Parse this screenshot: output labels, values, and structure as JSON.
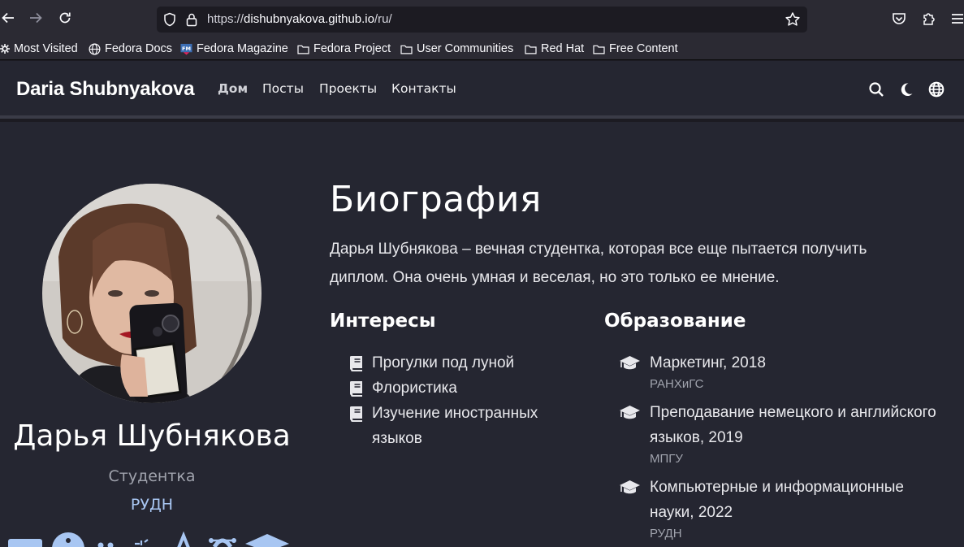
{
  "browser": {
    "url_prefix": "https://",
    "url_host": "dishubnyakova.github.io",
    "url_path": "/ru/",
    "bookmarks": [
      {
        "label": "Most Visited",
        "icon": "gear-icon"
      },
      {
        "label": "Fedora Docs",
        "icon": "globe-icon"
      },
      {
        "label": "Fedora Magazine",
        "icon": "fm-favicon-icon"
      },
      {
        "label": "Fedora Project",
        "icon": "folder-icon"
      },
      {
        "label": "User Communities",
        "icon": "folder-icon"
      },
      {
        "label": "Red Hat",
        "icon": "folder-icon"
      },
      {
        "label": "Free Content",
        "icon": "folder-icon"
      }
    ]
  },
  "site": {
    "brand": "Daria Shubnyakova",
    "nav": [
      "Дом",
      "Посты",
      "Проекты",
      "Контакты"
    ],
    "active_nav": "Дом"
  },
  "profile": {
    "name": "Дарья Шубнякова",
    "role": "Студентка",
    "org": "РУДН"
  },
  "bio": {
    "title": "Биография",
    "line1": "Дарья Шубнякова – вечная студентка, которая все еще пытается получить",
    "line2": "диплом. Она очень умная и веселая, но это только ее мнение."
  },
  "interests": {
    "title": "Интересы",
    "items": [
      "Прогулки под луной",
      "Флористика",
      "Изучение иностранных языков"
    ]
  },
  "education": {
    "title": "Образование",
    "items": [
      {
        "course": "Маркетинг, 2018",
        "institution": "РАНХиГС"
      },
      {
        "course": "Преподавание немецкого и английского языков, 2019",
        "institution": "МПГУ"
      },
      {
        "course": "Компьютерные и информационные науки, 2022",
        "institution": "РУДН"
      }
    ]
  },
  "colors": {
    "header_bg": "#252631",
    "accent_link": "#a8c6f2",
    "muted_text": "#a0a3ad"
  }
}
